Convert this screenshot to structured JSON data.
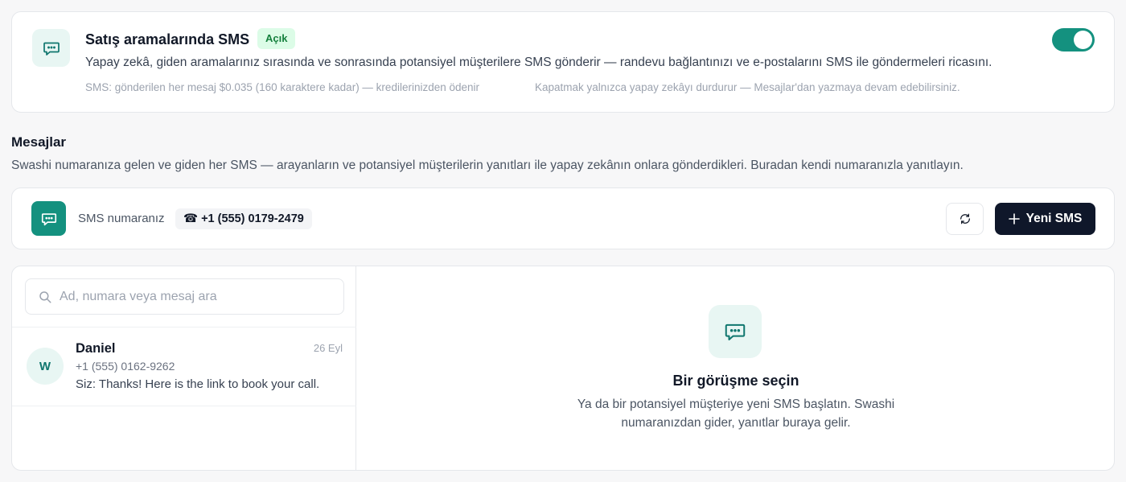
{
  "sms_feature": {
    "title": "Satış aramalarında SMS",
    "status_badge": "Açık",
    "enabled": true,
    "description": "Yapay zekâ, giden aramalarınız sırasında ve sonrasında potansiyel müşterilere SMS gönderir — randevu bağlantınızı ve e-postalarını SMS ile göndermeleri ricasını.",
    "pricing_note": "SMS: gönderilen her mesaj $0.035 (160 karaktere kadar) — kredilerinizden ödenir",
    "disable_note": "Kapatmak yalnızca yapay zekâyı durdurur — Mesajlar'dan yazmaya devam edebilirsiniz."
  },
  "messages": {
    "title": "Mesajlar",
    "description": "Swashi numaranıza gelen ve giden her SMS — arayanların ve potansiyel müşterilerin yanıtları ile yapay zekânın onlara gönderdikleri. Buradan kendi numaranızla yanıtlayın."
  },
  "number_bar": {
    "label": "SMS numaranız",
    "phone_glyph": "☎",
    "number": "+1 (555) 0179-2479",
    "new_sms_label": "Yeni SMS"
  },
  "search": {
    "placeholder": "Ad, numara veya mesaj ara",
    "value": ""
  },
  "conversations": [
    {
      "avatar_initial": "W",
      "name": "Daniel",
      "date": "26 Eyl",
      "phone": "+1 (555) 0162-9262",
      "last_message": "Siz: Thanks! Here is the link to book your call."
    }
  ],
  "empty_state": {
    "title": "Bir görüşme seçin",
    "description_line1": "Ya da bir potansiyel müşteriye yeni SMS başlatın. Swashi",
    "description_line2": "numaranızdan gider, yanıtlar buraya gelir."
  },
  "colors": {
    "accent": "#14917f",
    "accent_light": "#e8f6f3",
    "badge_bg": "#dcfce7",
    "badge_text": "#15803d",
    "primary_button": "#0f172a"
  },
  "icons": {
    "sms_feature": "chat-bubble-icon",
    "number_tile": "chat-bubble-icon",
    "refresh": "refresh-icon",
    "new_sms": "plus-icon",
    "search": "search-icon",
    "empty_state": "chat-bubble-icon"
  }
}
